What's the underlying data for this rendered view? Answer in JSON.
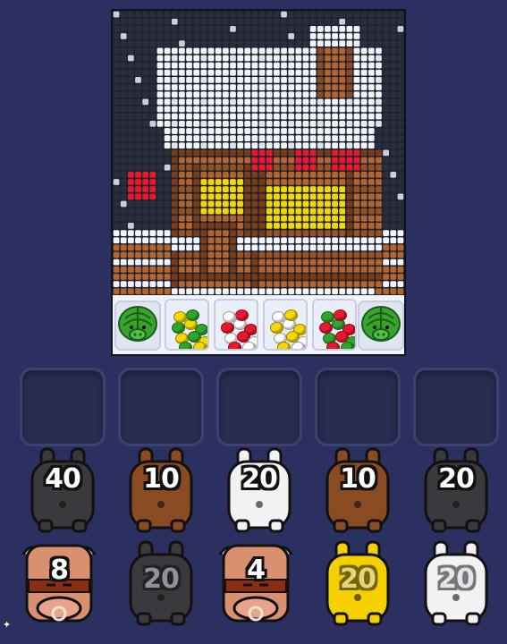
{
  "colors": {
    "background": "#2c3060",
    "snow": "#f3f5fb",
    "wood": "#b5652c",
    "window": "#f5d800",
    "red": "#e8192c",
    "night": "#2a2e3c"
  },
  "tray_bins": [
    {
      "type": "pig",
      "color": "green"
    },
    {
      "type": "balls",
      "colors": [
        "#2fa52c",
        "#f5d800"
      ]
    },
    {
      "type": "balls",
      "colors": [
        "#e8192c",
        "#ffffff"
      ]
    },
    {
      "type": "balls",
      "colors": [
        "#f5d800",
        "#ffffff"
      ]
    },
    {
      "type": "balls",
      "colors": [
        "#e8192c",
        "#2fa52c"
      ]
    },
    {
      "type": "pig",
      "color": "green"
    }
  ],
  "empty_slots": 5,
  "row1": [
    {
      "kind": "bunny",
      "color": "#3a3a3e",
      "count": "40"
    },
    {
      "kind": "bunny",
      "color": "#8a4a22",
      "count": "10"
    },
    {
      "kind": "bunny",
      "color": "#f2f2f4",
      "count": "20"
    },
    {
      "kind": "bunny",
      "color": "#8a4a22",
      "count": "10"
    },
    {
      "kind": "bunny",
      "color": "#3a3a3e",
      "count": "20"
    }
  ],
  "row2": [
    {
      "kind": "bull",
      "count": "8"
    },
    {
      "kind": "bunny",
      "color": "#3a3a3e",
      "count": "20",
      "dim": true
    },
    {
      "kind": "bull",
      "count": "4"
    },
    {
      "kind": "bunny",
      "color": "#f5d000",
      "count": "20",
      "dim": true
    },
    {
      "kind": "bunny",
      "color": "#f2f2f4",
      "count": "20",
      "dim": true
    }
  ]
}
